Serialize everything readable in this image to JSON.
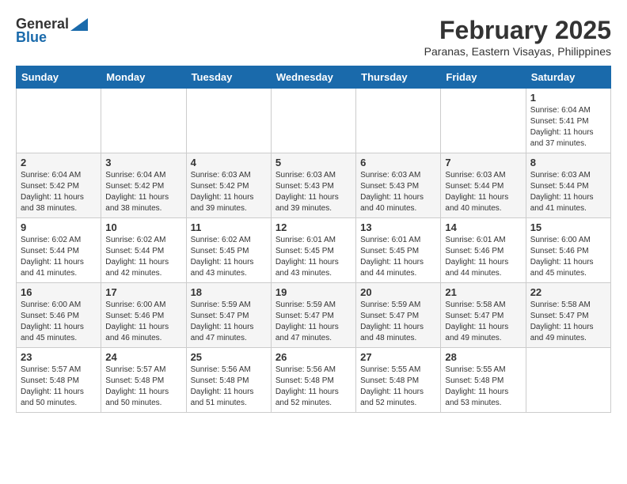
{
  "logo": {
    "general": "General",
    "blue": "Blue"
  },
  "title": {
    "month_year": "February 2025",
    "location": "Paranas, Eastern Visayas, Philippines"
  },
  "days_of_week": [
    "Sunday",
    "Monday",
    "Tuesday",
    "Wednesday",
    "Thursday",
    "Friday",
    "Saturday"
  ],
  "weeks": [
    [
      {
        "day": "",
        "info": ""
      },
      {
        "day": "",
        "info": ""
      },
      {
        "day": "",
        "info": ""
      },
      {
        "day": "",
        "info": ""
      },
      {
        "day": "",
        "info": ""
      },
      {
        "day": "",
        "info": ""
      },
      {
        "day": "1",
        "info": "Sunrise: 6:04 AM\nSunset: 5:41 PM\nDaylight: 11 hours and 37 minutes."
      }
    ],
    [
      {
        "day": "2",
        "info": "Sunrise: 6:04 AM\nSunset: 5:42 PM\nDaylight: 11 hours and 38 minutes."
      },
      {
        "day": "3",
        "info": "Sunrise: 6:04 AM\nSunset: 5:42 PM\nDaylight: 11 hours and 38 minutes."
      },
      {
        "day": "4",
        "info": "Sunrise: 6:03 AM\nSunset: 5:42 PM\nDaylight: 11 hours and 39 minutes."
      },
      {
        "day": "5",
        "info": "Sunrise: 6:03 AM\nSunset: 5:43 PM\nDaylight: 11 hours and 39 minutes."
      },
      {
        "day": "6",
        "info": "Sunrise: 6:03 AM\nSunset: 5:43 PM\nDaylight: 11 hours and 40 minutes."
      },
      {
        "day": "7",
        "info": "Sunrise: 6:03 AM\nSunset: 5:44 PM\nDaylight: 11 hours and 40 minutes."
      },
      {
        "day": "8",
        "info": "Sunrise: 6:03 AM\nSunset: 5:44 PM\nDaylight: 11 hours and 41 minutes."
      }
    ],
    [
      {
        "day": "9",
        "info": "Sunrise: 6:02 AM\nSunset: 5:44 PM\nDaylight: 11 hours and 41 minutes."
      },
      {
        "day": "10",
        "info": "Sunrise: 6:02 AM\nSunset: 5:44 PM\nDaylight: 11 hours and 42 minutes."
      },
      {
        "day": "11",
        "info": "Sunrise: 6:02 AM\nSunset: 5:45 PM\nDaylight: 11 hours and 43 minutes."
      },
      {
        "day": "12",
        "info": "Sunrise: 6:01 AM\nSunset: 5:45 PM\nDaylight: 11 hours and 43 minutes."
      },
      {
        "day": "13",
        "info": "Sunrise: 6:01 AM\nSunset: 5:45 PM\nDaylight: 11 hours and 44 minutes."
      },
      {
        "day": "14",
        "info": "Sunrise: 6:01 AM\nSunset: 5:46 PM\nDaylight: 11 hours and 44 minutes."
      },
      {
        "day": "15",
        "info": "Sunrise: 6:00 AM\nSunset: 5:46 PM\nDaylight: 11 hours and 45 minutes."
      }
    ],
    [
      {
        "day": "16",
        "info": "Sunrise: 6:00 AM\nSunset: 5:46 PM\nDaylight: 11 hours and 45 minutes."
      },
      {
        "day": "17",
        "info": "Sunrise: 6:00 AM\nSunset: 5:46 PM\nDaylight: 11 hours and 46 minutes."
      },
      {
        "day": "18",
        "info": "Sunrise: 5:59 AM\nSunset: 5:47 PM\nDaylight: 11 hours and 47 minutes."
      },
      {
        "day": "19",
        "info": "Sunrise: 5:59 AM\nSunset: 5:47 PM\nDaylight: 11 hours and 47 minutes."
      },
      {
        "day": "20",
        "info": "Sunrise: 5:59 AM\nSunset: 5:47 PM\nDaylight: 11 hours and 48 minutes."
      },
      {
        "day": "21",
        "info": "Sunrise: 5:58 AM\nSunset: 5:47 PM\nDaylight: 11 hours and 49 minutes."
      },
      {
        "day": "22",
        "info": "Sunrise: 5:58 AM\nSunset: 5:47 PM\nDaylight: 11 hours and 49 minutes."
      }
    ],
    [
      {
        "day": "23",
        "info": "Sunrise: 5:57 AM\nSunset: 5:48 PM\nDaylight: 11 hours and 50 minutes."
      },
      {
        "day": "24",
        "info": "Sunrise: 5:57 AM\nSunset: 5:48 PM\nDaylight: 11 hours and 50 minutes."
      },
      {
        "day": "25",
        "info": "Sunrise: 5:56 AM\nSunset: 5:48 PM\nDaylight: 11 hours and 51 minutes."
      },
      {
        "day": "26",
        "info": "Sunrise: 5:56 AM\nSunset: 5:48 PM\nDaylight: 11 hours and 52 minutes."
      },
      {
        "day": "27",
        "info": "Sunrise: 5:55 AM\nSunset: 5:48 PM\nDaylight: 11 hours and 52 minutes."
      },
      {
        "day": "28",
        "info": "Sunrise: 5:55 AM\nSunset: 5:48 PM\nDaylight: 11 hours and 53 minutes."
      },
      {
        "day": "",
        "info": ""
      }
    ]
  ]
}
